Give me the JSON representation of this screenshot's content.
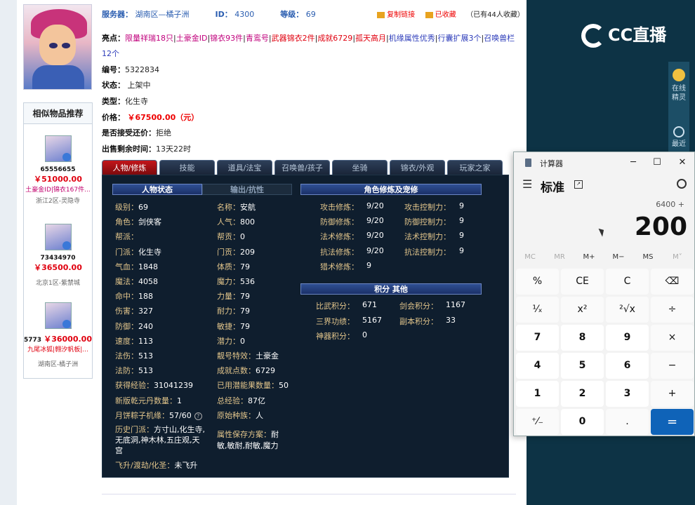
{
  "header": {
    "server_label": "服务器：",
    "server_value": "湖南区—橘子洲",
    "id_label": "ID：",
    "id_value": "4300",
    "level_label": "等级：",
    "level_value": "69",
    "copy_link": "复制链接",
    "favorited": "已收藏",
    "fav_count_text": "（已有44人收藏）"
  },
  "highlights": {
    "label": "亮点：",
    "items": [
      {
        "text": "限量祥瑞18只",
        "color": "#c0007c"
      },
      {
        "text": "土豪金ID",
        "color": "#c0007c"
      },
      {
        "text": "锦衣93件",
        "color": "#c0007c"
      },
      {
        "text": "青鸾号",
        "color": "#c0007c"
      },
      {
        "text": "武器锦衣2件",
        "color": "#e0000f"
      },
      {
        "text": "成就6729",
        "color": "#e0000f"
      },
      {
        "text": "孤天高月",
        "color": "#e0000f"
      },
      {
        "text": "机缘属性优秀",
        "color": "#2d3cba"
      },
      {
        "text": "行囊扩展3个",
        "color": "#2d3cba"
      },
      {
        "text": "召唤兽栏12个",
        "color": "#2d3cba"
      }
    ]
  },
  "details": {
    "number_label": "编号：",
    "number_value": "5322834",
    "status_label": "状态：",
    "status_value": "上架中",
    "type_label": "类型：",
    "type_value": "化生寺",
    "price_label": "价格：",
    "price_value": "￥67500.00（元）",
    "bargain_label": "是否接受还价：",
    "bargain_value": "拒绝",
    "remain_label": "出售剩余时间：",
    "remain_value": "13天22时"
  },
  "similar": {
    "title": "相似物品推荐",
    "items": [
      {
        "id": "65556655",
        "price": "￥51000.00",
        "tags": "土豪金ID|锦衣167件...",
        "server": "浙江2区-灵隐寺"
      },
      {
        "id": "73434970",
        "price": "￥36500.00",
        "tags": "",
        "server": "北京1区-紫禁城"
      },
      {
        "id": "5773",
        "price": "￥36000.00",
        "tags": "九尾冰狐|翱汐帆板|...",
        "server": "湖南区-橘子洲"
      }
    ]
  },
  "tabs": [
    "人物/修炼",
    "技能",
    "道具/法宝",
    "召唤兽/孩子",
    "坐骑",
    "锦衣/外观",
    "玩家之家"
  ],
  "panel": {
    "head_status": "人物状态",
    "head_output": "输出/抗性",
    "head_cultivation": "角色修炼及宠修",
    "head_points": "积分 其他",
    "col1": [
      {
        "k": "级别：",
        "v": "69"
      },
      {
        "k": "角色：",
        "v": "剑侠客"
      },
      {
        "k": "帮派：",
        "v": ""
      },
      {
        "k": "门派：",
        "v": "化生寺"
      },
      {
        "k": "气血：",
        "v": "1848"
      },
      {
        "k": "魔法：",
        "v": "4058"
      },
      {
        "k": "命中：",
        "v": "188"
      },
      {
        "k": "伤害：",
        "v": "327"
      },
      {
        "k": "防御：",
        "v": "240"
      },
      {
        "k": "速度：",
        "v": "113"
      },
      {
        "k": "法伤：",
        "v": "513"
      },
      {
        "k": "法防：",
        "v": "513"
      },
      {
        "k": "获得经验：",
        "v": "31041239"
      },
      {
        "k": "新版乾元丹数量：",
        "v": "1"
      },
      {
        "k": "月饼粽子机缘：",
        "v": "57/60"
      }
    ],
    "col2": [
      {
        "k": "名称：",
        "v": "安航"
      },
      {
        "k": "人气：",
        "v": "800"
      },
      {
        "k": "帮贡：",
        "v": "0"
      },
      {
        "k": "门贡：",
        "v": "209"
      },
      {
        "k": "体质：",
        "v": "79"
      },
      {
        "k": "魔力：",
        "v": "536"
      },
      {
        "k": "力量：",
        "v": "79"
      },
      {
        "k": "耐力：",
        "v": "79"
      },
      {
        "k": "敏捷：",
        "v": "79"
      },
      {
        "k": "潜力：",
        "v": "0"
      },
      {
        "k": "靓号特效：",
        "v": "土豪金"
      },
      {
        "k": "成就点数：",
        "v": "6729"
      },
      {
        "k": "已用潜能果数量：",
        "v": "50"
      },
      {
        "k": "总经验：",
        "v": "87亿"
      },
      {
        "k": "原始种族：",
        "v": "人"
      }
    ],
    "history_label": "历史门派：",
    "history_line1": "方寸山,化生寺,",
    "history_line2": "无底洞,神木林,五庄观,天",
    "history_line3": "宫",
    "attr_label": "属性保存方案：",
    "attr_line1": "耐",
    "attr_line2": "敏,敏耐,耐敏,魔力",
    "fly_label": "飞升/渡劫/化圣：",
    "fly_value": "未飞升",
    "cult_left": [
      {
        "k": "攻击修炼：",
        "v": "9/20"
      },
      {
        "k": "防御修炼：",
        "v": "9/20"
      },
      {
        "k": "法术修炼：",
        "v": "9/20"
      },
      {
        "k": "抗法修炼：",
        "v": "9/20"
      },
      {
        "k": "猎术修炼：",
        "v": "9"
      }
    ],
    "cult_right": [
      {
        "k": "攻击控制力：",
        "v": "9"
      },
      {
        "k": "防御控制力：",
        "v": "9"
      },
      {
        "k": "法术控制力：",
        "v": "9"
      },
      {
        "k": "抗法控制力：",
        "v": "9"
      }
    ],
    "points": [
      {
        "k": "比武积分：",
        "v": "671"
      },
      {
        "k": "剑会积分：",
        "v": "1167"
      },
      {
        "k": "三界功绩：",
        "v": "5167"
      },
      {
        "k": "副本积分：",
        "v": "33"
      },
      {
        "k": "神器积分：",
        "v": "0"
      }
    ]
  },
  "cc": {
    "logo_text": "CC直播",
    "online_elf": "在线精灵",
    "recent": "最近"
  },
  "calculator": {
    "title": "计算器",
    "mode": "标准",
    "expression": "6400 +",
    "display": "200",
    "memory": [
      "MC",
      "MR",
      "M+",
      "M−",
      "MS",
      "M˅"
    ],
    "keys": [
      "%",
      "CE",
      "C",
      "⌫",
      "¹⁄ₓ",
      "x²",
      "²√x",
      "÷",
      "7",
      "8",
      "9",
      "×",
      "4",
      "5",
      "6",
      "−",
      "1",
      "2",
      "3",
      "+",
      "⁺⁄₋",
      "0",
      ".",
      "="
    ]
  }
}
